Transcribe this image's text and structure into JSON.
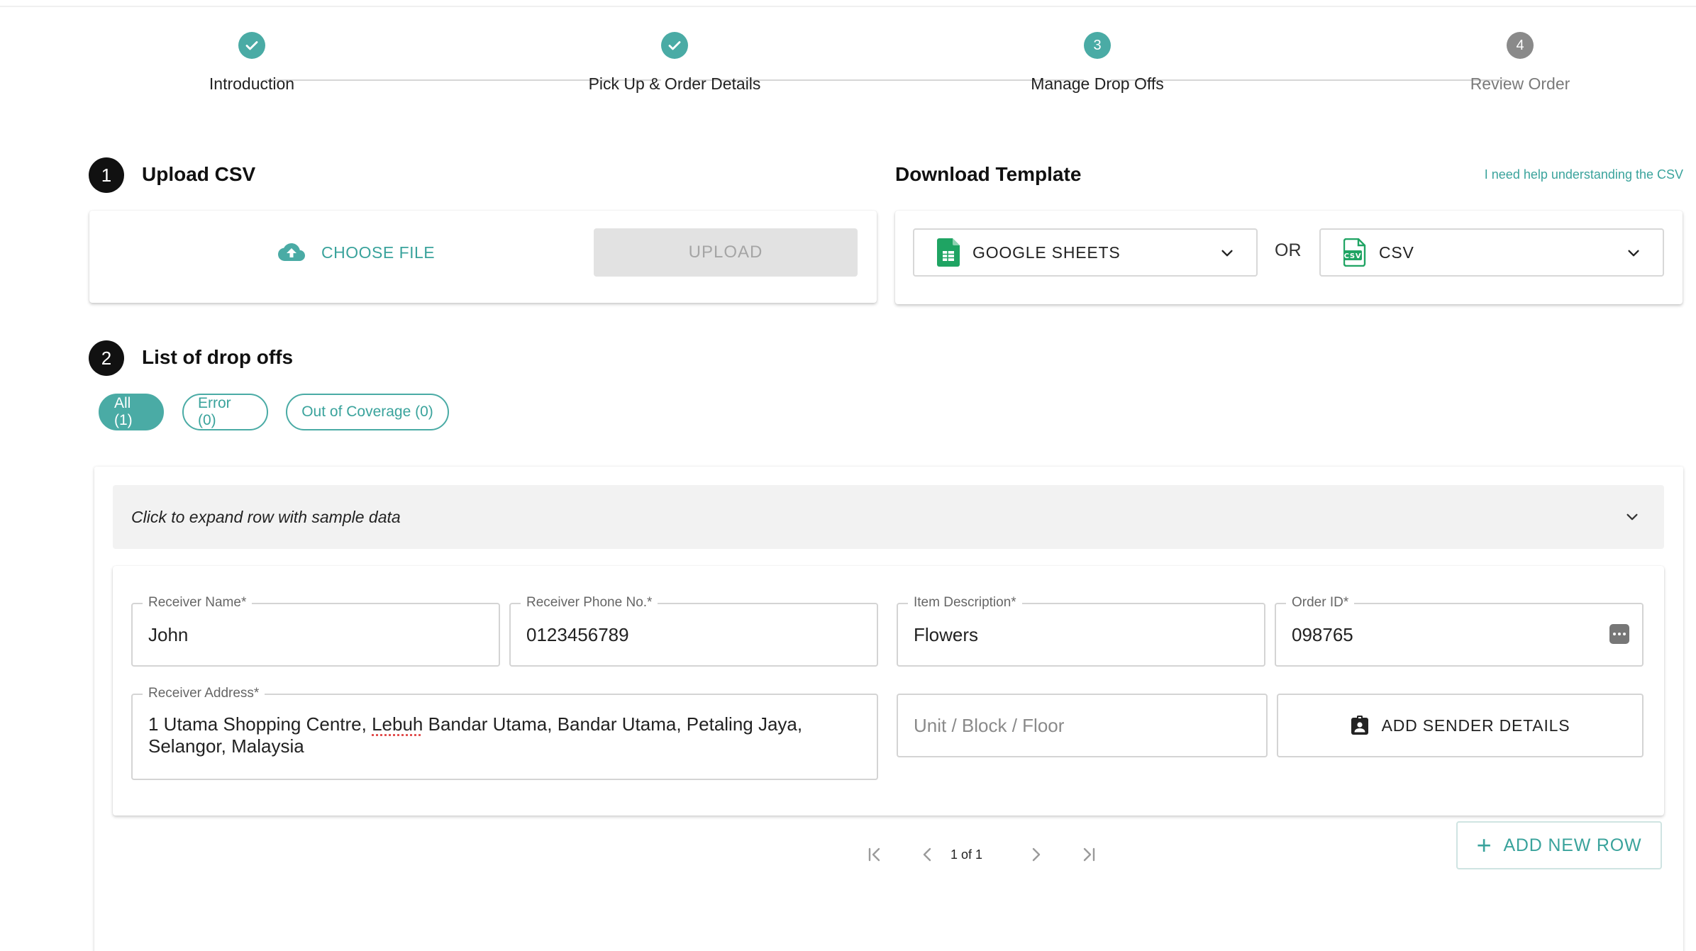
{
  "stepper": {
    "steps": [
      {
        "label": "Introduction",
        "state": "done"
      },
      {
        "label": "Pick Up & Order Details",
        "state": "done"
      },
      {
        "label": "Manage Drop Offs",
        "number": "3",
        "state": "active"
      },
      {
        "label": "Review Order",
        "number": "4",
        "state": "pending"
      }
    ]
  },
  "upload": {
    "number": "1",
    "title": "Upload CSV",
    "choose_file_label": "CHOOSE FILE",
    "upload_label": "UPLOAD"
  },
  "template": {
    "title": "Download Template",
    "help_link": "I need help understanding the CSV",
    "google_sheets_label": "GOOGLE SHEETS",
    "or_label": "OR",
    "csv_label": "CSV"
  },
  "dropoffs": {
    "number": "2",
    "title": "List of drop offs",
    "filters": [
      {
        "label": "All (1)",
        "active": true
      },
      {
        "label": "Error (0)",
        "active": false
      },
      {
        "label": "Out of Coverage (0)",
        "active": false
      }
    ],
    "expand_hint": "Click to expand row with sample data",
    "row": {
      "receiver_name_label": "Receiver Name",
      "receiver_name": "John",
      "receiver_phone_label": "Receiver Phone No.",
      "receiver_phone": "0123456789",
      "item_description_label": "Item Description",
      "item_description": "Flowers",
      "order_id_label": "Order ID",
      "order_id": "098765",
      "receiver_address_label": "Receiver Address",
      "address_part1": "1 Utama Shopping Centre, ",
      "address_misspelled": "Lebuh",
      "address_part2": " Bandar Utama, Bandar Utama, Petaling Jaya,",
      "address_line2": "Selangor, Malaysia",
      "unit_placeholder": "Unit / Block / Floor",
      "add_sender_label": "ADD SENDER DETAILS",
      "required_mark": "*"
    },
    "pagination": {
      "text": "1 of 1"
    },
    "add_row_label": "ADD NEW ROW"
  },
  "colors": {
    "accent": "#4aaba5",
    "accent_text": "#3aa39c",
    "pending": "#8a8a8a",
    "sheets_green": "#1fa463"
  },
  "icons": [
    "check-icon",
    "cloud-upload-icon",
    "google-sheets-icon",
    "csv-file-icon",
    "chevron-down-icon",
    "more-icon",
    "contact-card-icon",
    "first-page-icon",
    "prev-page-icon",
    "next-page-icon",
    "last-page-icon",
    "plus-icon"
  ]
}
